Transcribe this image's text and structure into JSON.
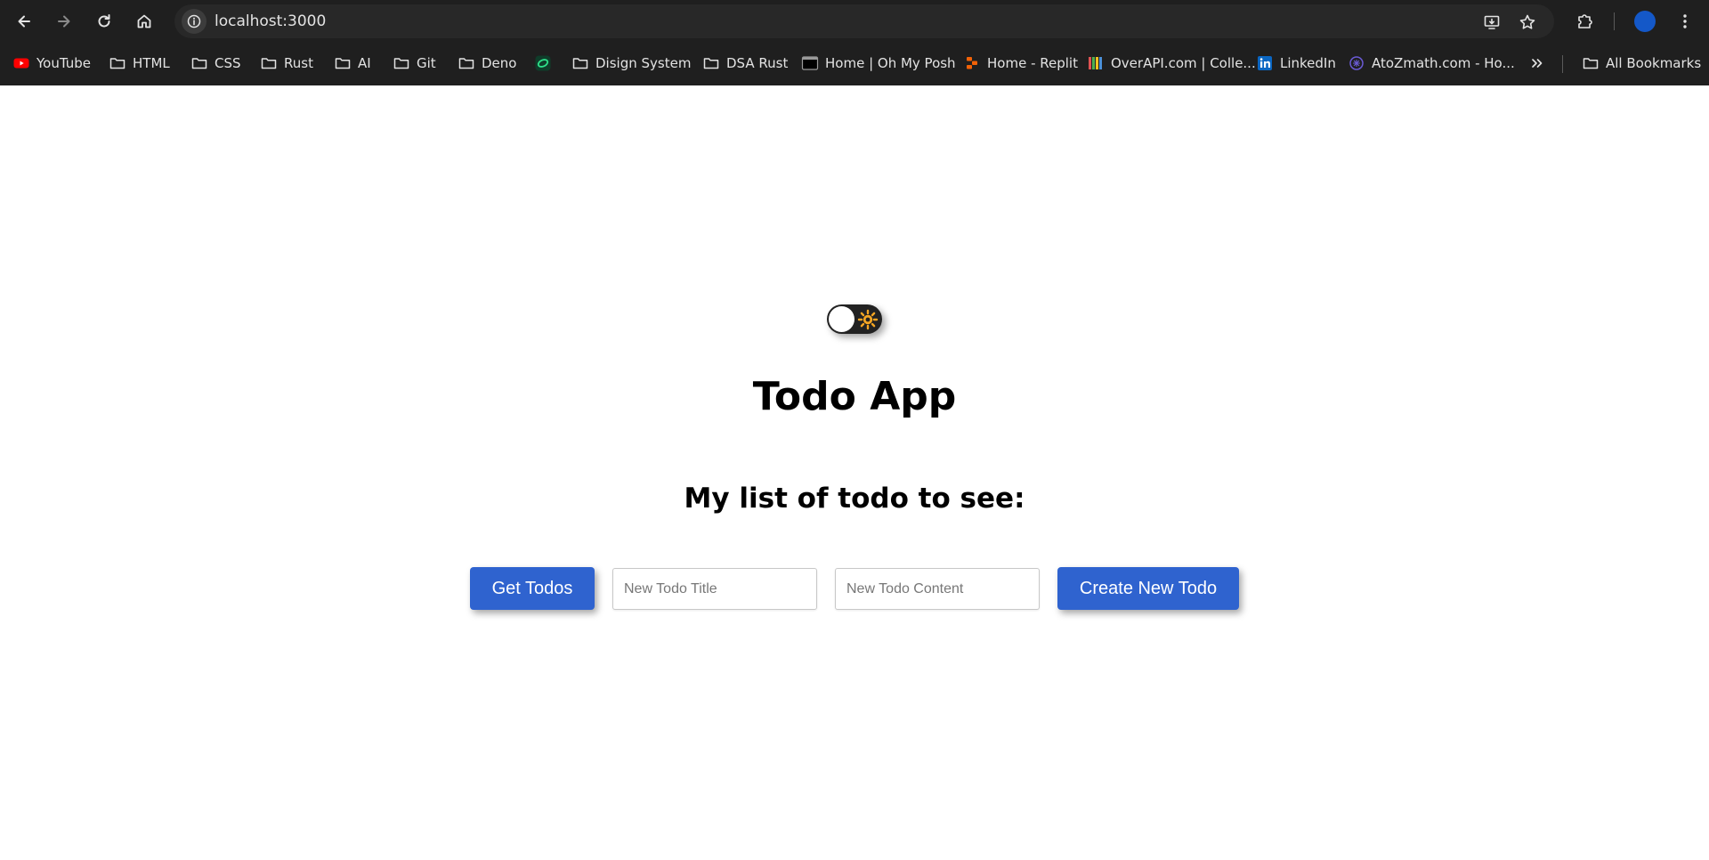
{
  "browser": {
    "url": "localhost:3000",
    "icons": {
      "back": "arrow-left-icon",
      "forward": "arrow-right-icon",
      "reload": "reload-icon",
      "home": "home-icon",
      "site_info": "info-icon",
      "install": "install-app-icon",
      "bookmark": "star-icon",
      "extensions": "puzzle-icon",
      "profile": "avatar",
      "menu": "kebab-menu-icon"
    }
  },
  "bookmarks": {
    "items": [
      {
        "label": "YouTube",
        "icon": "youtube-icon"
      },
      {
        "label": "HTML",
        "icon": "folder-icon"
      },
      {
        "label": "CSS",
        "icon": "folder-icon"
      },
      {
        "label": "Rust",
        "icon": "folder-icon"
      },
      {
        "label": "AI",
        "icon": "folder-icon"
      },
      {
        "label": "Git",
        "icon": "folder-icon"
      },
      {
        "label": "Deno",
        "icon": "folder-icon"
      },
      {
        "label": "",
        "icon": "green-site-icon"
      },
      {
        "label": "Disign System",
        "icon": "folder-icon"
      },
      {
        "label": "DSA Rust",
        "icon": "folder-icon"
      },
      {
        "label": "Home | Oh My Posh",
        "icon": "terminal-icon"
      },
      {
        "label": "Home - Replit",
        "icon": "replit-icon"
      },
      {
        "label": "OverAPI.com | Colle...",
        "icon": "overapi-icon"
      },
      {
        "label": "LinkedIn",
        "icon": "linkedin-icon"
      },
      {
        "label": "AtoZmath.com - Ho...",
        "icon": "atozmath-icon"
      }
    ],
    "overflow_icon": "chevron-double-right-icon",
    "all_bookmarks": "All Bookmarks"
  },
  "app": {
    "theme_toggle_icon": "sun-icon",
    "title": "Todo App",
    "subtitle": "My list of todo to see:",
    "get_todos_label": "Get Todos",
    "title_input_placeholder": "New Todo Title",
    "title_input_value": "",
    "content_input_placeholder": "New Todo Content",
    "content_input_value": "",
    "create_label": "Create New Todo"
  },
  "colors": {
    "chrome_bg": "#1f1f1f",
    "omnibox_bg": "#282828",
    "button_blue": "#2f63cf",
    "toggle_bg": "#222222",
    "sun": "#f5a623"
  }
}
